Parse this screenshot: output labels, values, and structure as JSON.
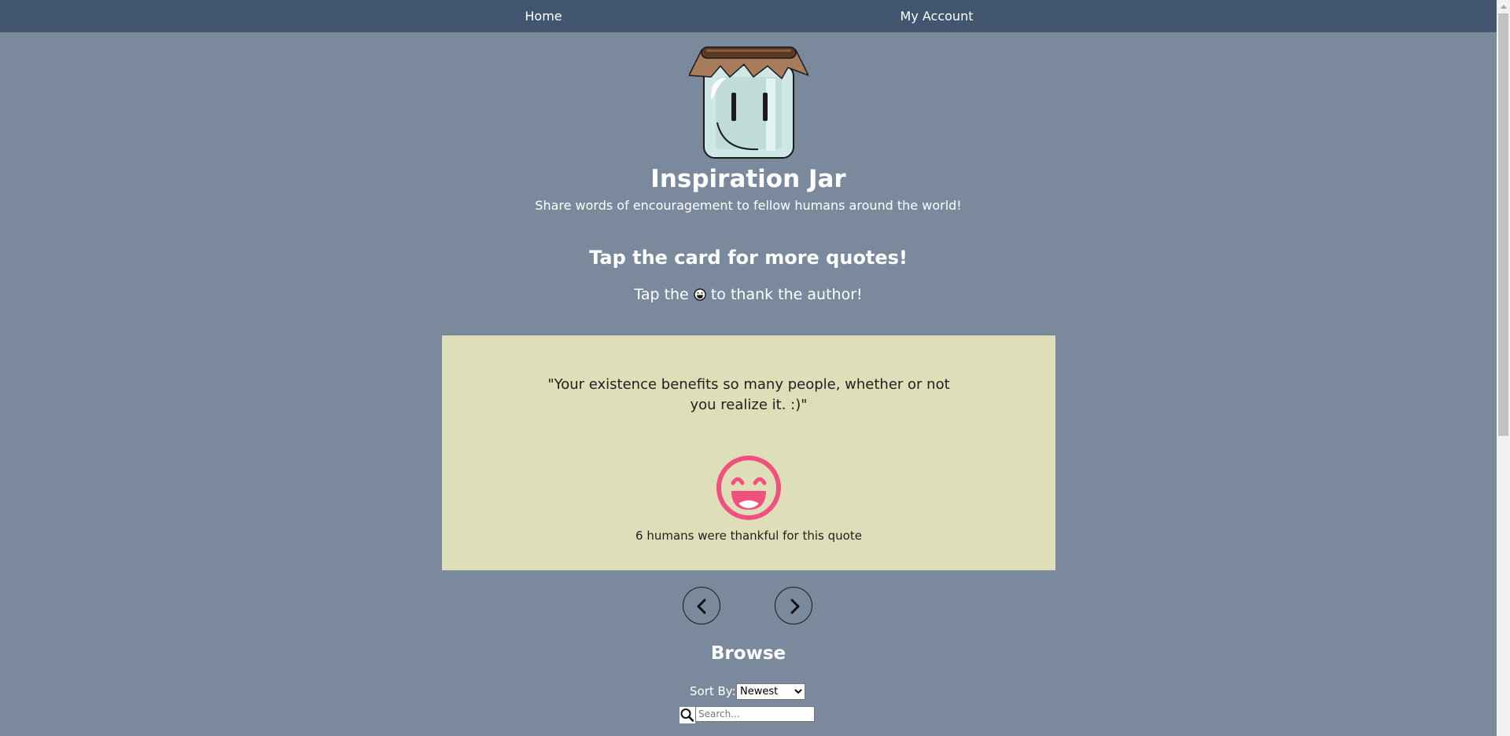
{
  "nav": {
    "home_label": "Home",
    "account_label": "My Account"
  },
  "header": {
    "title": "Inspiration Jar",
    "subtitle": "Share words of encouragement to fellow humans around the world!"
  },
  "instructions": {
    "tap_card": "Tap the card for more quotes!",
    "tap_thank_before": "Tap the",
    "tap_thank_after": "to thank the author!"
  },
  "card": {
    "quote": "\"Your existence benefits so many people, whether or not you realize it. :)\"",
    "thank_count_text": "6 humans were thankful for this quote",
    "background": "#dedfb8",
    "smile_color": "#f0507e"
  },
  "browse": {
    "title": "Browse",
    "sort_label": "Sort By:",
    "sort_selected": "Newest",
    "search_placeholder": "Search..."
  },
  "colors": {
    "nav_bg": "#42566f",
    "page_bg": "#7a8a9c"
  },
  "icons": {
    "logo": "jar-logo",
    "thank": "grinning-face-icon",
    "prev": "chevron-left-icon",
    "next": "chevron-right-icon",
    "search": "search-icon"
  }
}
